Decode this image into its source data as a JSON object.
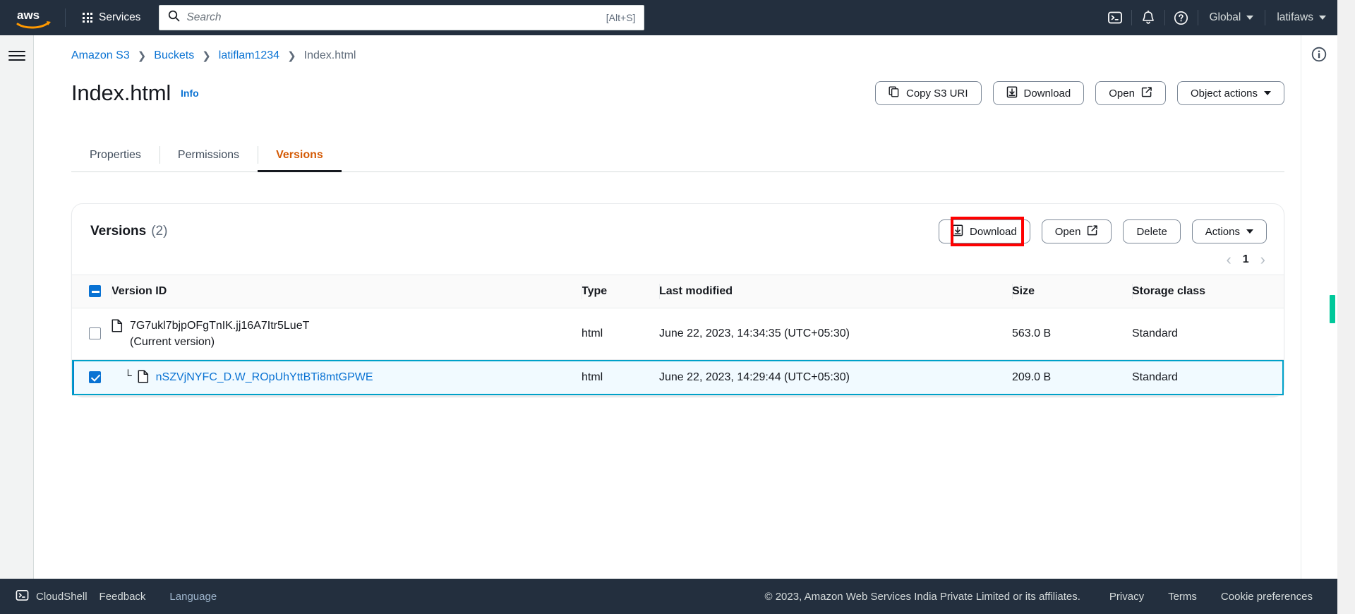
{
  "topnav": {
    "logo_alt": "aws",
    "services_label": "Services",
    "search_placeholder": "Search",
    "search_value": "",
    "search_shortcut": "[Alt+S]",
    "cloudshell_icon": "cloudshell-icon",
    "notifications_icon": "bell-icon",
    "help_icon": "question-circle-icon",
    "region_label": "Global",
    "account_label": "latifaws"
  },
  "breadcrumb": [
    {
      "label": "Amazon S3",
      "link": true
    },
    {
      "label": "Buckets",
      "link": true
    },
    {
      "label": "latiflam1234",
      "link": true
    },
    {
      "label": "Index.html",
      "link": false
    }
  ],
  "page": {
    "title": "Index.html",
    "info_label": "Info"
  },
  "title_actions": [
    {
      "label": "Copy S3 URI",
      "icon": "copy-icon",
      "icon_pos": "left"
    },
    {
      "label": "Download",
      "icon": "download-icon",
      "icon_pos": "left"
    },
    {
      "label": "Open",
      "icon": "external-link-icon",
      "icon_pos": "right"
    },
    {
      "label": "Object actions",
      "icon": "caret-down-icon",
      "icon_pos": "right"
    }
  ],
  "tabs": [
    {
      "label": "Properties",
      "active": false
    },
    {
      "label": "Permissions",
      "active": false
    },
    {
      "label": "Versions",
      "active": true
    }
  ],
  "versions_card": {
    "title": "Versions",
    "count": "(2)",
    "actions": [
      {
        "label": "Download",
        "icon": "download-icon",
        "icon_pos": "left",
        "highlighted": true
      },
      {
        "label": "Open",
        "icon": "external-link-icon",
        "icon_pos": "right",
        "highlighted": false
      },
      {
        "label": "Delete",
        "icon": "",
        "icon_pos": "",
        "highlighted": false
      },
      {
        "label": "Actions",
        "icon": "caret-down-icon",
        "icon_pos": "right",
        "highlighted": false
      }
    ],
    "pagination": {
      "prev": "‹",
      "page": "1",
      "next": "›"
    },
    "columns": [
      "Version ID",
      "Type",
      "Last modified",
      "Size",
      "Storage class"
    ],
    "header_checkbox_state": "indeterminate",
    "rows": [
      {
        "checked": false,
        "selected": false,
        "nested": false,
        "version_id": "7G7ukl7bjpOFgTnIK.jj16A7Itr5LueT",
        "version_id_link": false,
        "sublabel": "(Current version)",
        "type": "html",
        "last_modified": "June 22, 2023, 14:34:35 (UTC+05:30)",
        "size": "563.0 B",
        "storage_class": "Standard"
      },
      {
        "checked": true,
        "selected": true,
        "nested": true,
        "version_id": "nSZVjNYFC_D.W_ROpUhYttBTi8mtGPWE",
        "version_id_link": true,
        "sublabel": "",
        "type": "html",
        "last_modified": "June 22, 2023, 14:29:44 (UTC+05:30)",
        "size": "209.0 B",
        "storage_class": "Standard"
      }
    ]
  },
  "footer": {
    "cloudshell": "CloudShell",
    "feedback": "Feedback",
    "language": "Language",
    "copyright": "© 2023, Amazon Web Services India Private Limited or its affiliates.",
    "privacy": "Privacy",
    "terms": "Terms",
    "cookies": "Cookie preferences"
  },
  "colors": {
    "nav_bg": "#232f3e",
    "accent_orange": "#d45b07",
    "link_blue": "#0972d3",
    "highlight_red": "#ff0000",
    "selected_row": "#f1faff",
    "scroll_marker_green": "#00c89a"
  }
}
